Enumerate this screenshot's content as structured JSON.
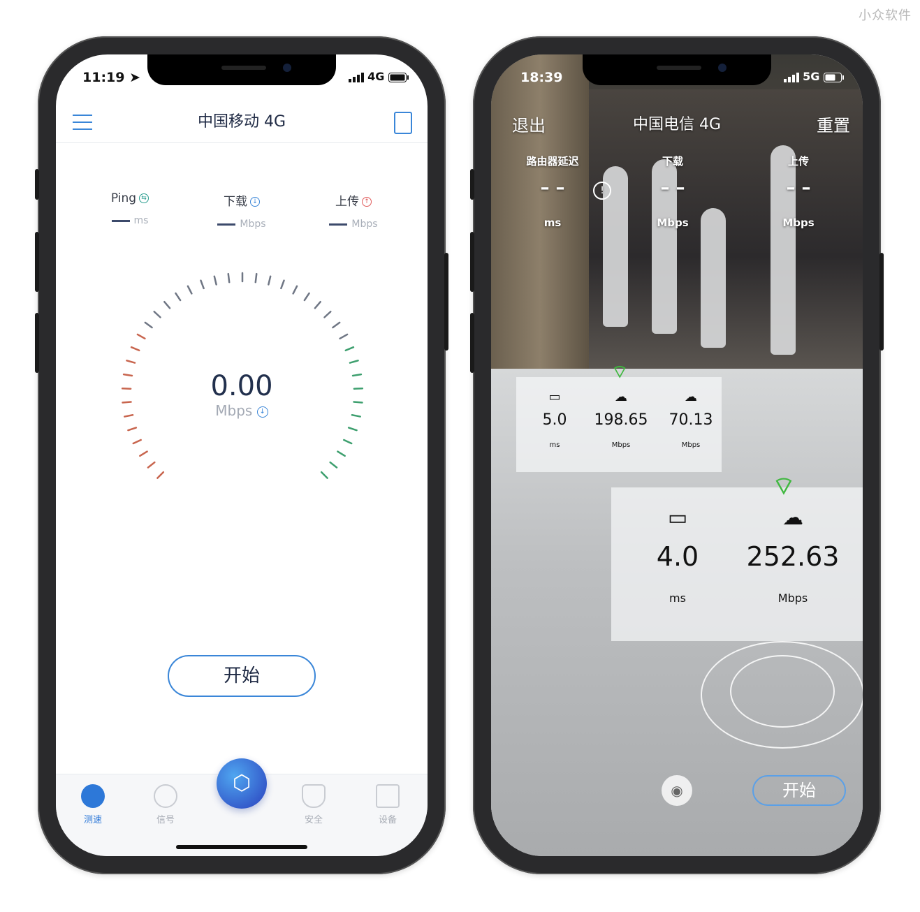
{
  "watermark": "小众软件",
  "left": {
    "status": {
      "time": "11:19",
      "network": "4G"
    },
    "header": {
      "title": "中国移动 4G"
    },
    "metrics": [
      {
        "label": "Ping",
        "unit": "ms",
        "icon": "ping-icon"
      },
      {
        "label": "下载",
        "unit": "Mbps",
        "icon": "download-icon"
      },
      {
        "label": "上传",
        "unit": "Mbps",
        "icon": "upload-icon"
      }
    ],
    "gauge": {
      "value": "0.00",
      "unit": "Mbps"
    },
    "start_label": "开始",
    "tabs": [
      {
        "label": "测速",
        "icon": "speedometer-icon"
      },
      {
        "label": "信号",
        "icon": "signal-icon"
      },
      {
        "label": "安全",
        "icon": "shield-icon"
      },
      {
        "label": "设备",
        "icon": "devices-icon"
      }
    ],
    "colors": {
      "accent": "#3a86d8",
      "ping": "#2a9d8f",
      "upload": "#e05a5a"
    }
  },
  "right": {
    "status": {
      "time": "18:39",
      "network": "5G"
    },
    "header": {
      "exit": "退出",
      "title": "中国电信 4G",
      "reset": "重置"
    },
    "metrics": [
      {
        "label": "路由器延迟",
        "value": "– –",
        "unit": "ms"
      },
      {
        "label": "下载",
        "value": "– –",
        "unit": "Mbps"
      },
      {
        "label": "上传",
        "value": "– –",
        "unit": "Mbps"
      }
    ],
    "panel_small": [
      {
        "value": "5.0",
        "unit": "ms",
        "icon": "router-icon"
      },
      {
        "value": "198.65",
        "unit": "Mbps",
        "icon": "cloud-download-icon"
      },
      {
        "value": "70.13",
        "unit": "Mbps",
        "icon": "cloud-upload-icon"
      }
    ],
    "panel_large": [
      {
        "value": "4.0",
        "unit": "ms",
        "icon": "router-icon"
      },
      {
        "value": "252.63",
        "unit": "Mbps",
        "icon": "cloud-download-icon"
      }
    ],
    "start_label": "开始"
  }
}
